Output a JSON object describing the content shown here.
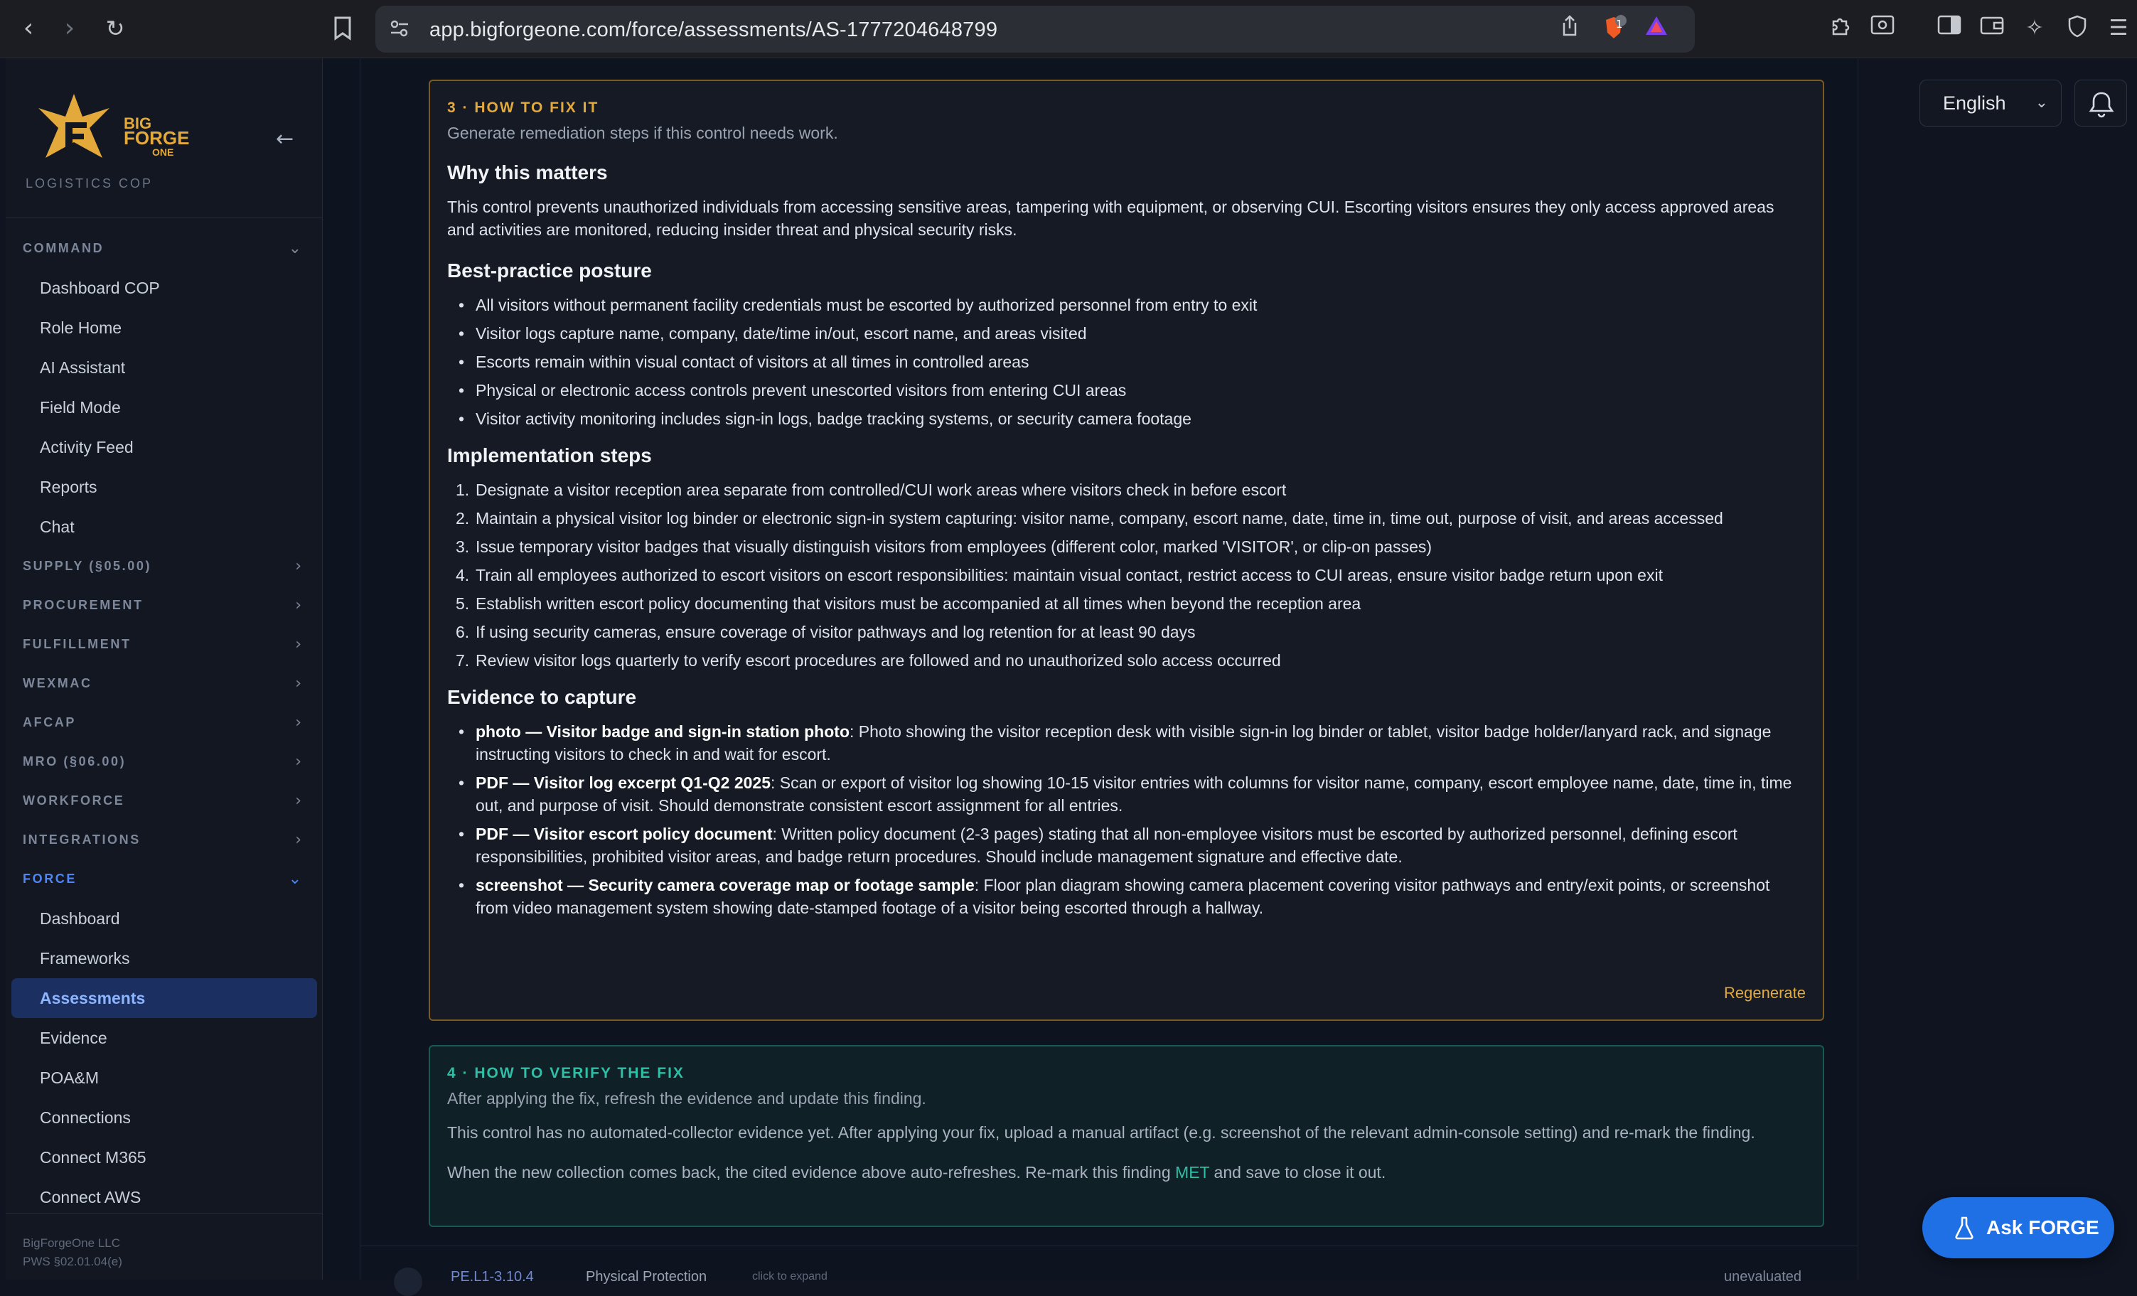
{
  "browser": {
    "url": "app.bigforgeone.com/force/assessments/AS-1777204648799",
    "shields_count": "1"
  },
  "sidebar": {
    "brand_line1": "BIG",
    "brand_line2": "FORGE",
    "brand_line3": "ONE",
    "brand_sub": "LOGISTICS COP",
    "sections": [
      {
        "label": "COMMAND",
        "expanded": true,
        "items": [
          "Dashboard COP",
          "Role Home",
          "AI Assistant",
          "Field Mode",
          "Activity Feed",
          "Reports",
          "Chat"
        ]
      },
      {
        "label": "SUPPLY (§05.00)",
        "expanded": false,
        "items": []
      },
      {
        "label": "PROCUREMENT",
        "expanded": false,
        "items": []
      },
      {
        "label": "FULFILLMENT",
        "expanded": false,
        "items": []
      },
      {
        "label": "WEXMAC",
        "expanded": false,
        "items": []
      },
      {
        "label": "AFCAP",
        "expanded": false,
        "items": []
      },
      {
        "label": "MRO (§06.00)",
        "expanded": false,
        "items": []
      },
      {
        "label": "WORKFORCE",
        "expanded": false,
        "items": []
      },
      {
        "label": "INTEGRATIONS",
        "expanded": false,
        "items": []
      },
      {
        "label": "FORCE",
        "expanded": true,
        "active": true,
        "items": [
          "Dashboard",
          "Frameworks",
          "Assessments",
          "Evidence",
          "POA&M",
          "Connections",
          "Connect M365",
          "Connect AWS"
        ]
      }
    ],
    "active_item": "Assessments",
    "footer_line1": "BigForgeOne LLC",
    "footer_line2": "PWS §02.01.04(e)"
  },
  "fix": {
    "label": "3 · HOW TO FIX IT",
    "subtitle": "Generate remediation steps if this control needs work.",
    "why_heading": "Why this matters",
    "why_text": "This control prevents unauthorized individuals from accessing sensitive areas, tampering with equipment, or observing CUI. Escorting visitors ensures they only access approved areas and activities are monitored, reducing insider threat and physical security risks.",
    "posture_heading": "Best-practice posture",
    "posture": [
      "All visitors without permanent facility credentials must be escorted by authorized personnel from entry to exit",
      "Visitor logs capture name, company, date/time in/out, escort name, and areas visited",
      "Escorts remain within visual contact of visitors at all times in controlled areas",
      "Physical or electronic access controls prevent unescorted visitors from entering CUI areas",
      "Visitor activity monitoring includes sign-in logs, badge tracking systems, or security camera footage"
    ],
    "steps_heading": "Implementation steps",
    "steps": [
      "Designate a visitor reception area separate from controlled/CUI work areas where visitors check in before escort",
      "Maintain a physical visitor log binder or electronic sign-in system capturing: visitor name, company, escort name, date, time in, time out, purpose of visit, and areas accessed",
      "Issue temporary visitor badges that visually distinguish visitors from employees (different color, marked 'VISITOR', or clip-on passes)",
      "Train all employees authorized to escort visitors on escort responsibilities: maintain visual contact, restrict access to CUI areas, ensure visitor badge return upon exit",
      "Establish written escort policy documenting that visitors must be accompanied at all times when beyond the reception area",
      "If using security cameras, ensure coverage of visitor pathways and log retention for at least 90 days",
      "Review visitor logs quarterly to verify escort procedures are followed and no unauthorized solo access occurred"
    ],
    "evidence_heading": "Evidence to capture",
    "evidence": [
      {
        "title": "photo — Visitor badge and sign-in station photo",
        "text": ": Photo showing the visitor reception desk with visible sign-in log binder or tablet, visitor badge holder/lanyard rack, and signage instructing visitors to check in and wait for escort."
      },
      {
        "title": "PDF — Visitor log excerpt Q1-Q2 2025",
        "text": ": Scan or export of visitor log showing 10-15 visitor entries with columns for visitor name, company, escort employee name, date, time in, time out, and purpose of visit. Should demonstrate consistent escort assignment for all entries."
      },
      {
        "title": "PDF — Visitor escort policy document",
        "text": ": Written policy document (2-3 pages) stating that all non-employee visitors must be escorted by authorized personnel, defining escort responsibilities, prohibited visitor areas, and badge return procedures. Should include management signature and effective date."
      },
      {
        "title": "screenshot — Security camera coverage map or footage sample",
        "text": ": Floor plan diagram showing camera placement covering visitor pathways and entry/exit points, or screenshot from video management system showing date-stamped footage of a visitor being escorted through a hallway."
      }
    ],
    "regenerate": "Regenerate"
  },
  "verify": {
    "label": "4 · HOW TO VERIFY THE FIX",
    "subtitle": "After applying the fix, refresh the evidence and update this finding.",
    "text1": "This control has no automated-collector evidence yet. After applying your fix, upload a manual artifact (e.g. screenshot of the relevant admin-console setting) and re-mark the finding.",
    "text2_before": "When the new collection comes back, the cited evidence above auto-refreshes. Re-mark this finding ",
    "text2_met": "MET",
    "text2_after": " and save to close it out."
  },
  "next_row": {
    "code": "PE.L1-3.10.4",
    "family": "Physical Protection",
    "hint": "click to expand",
    "status": "unevaluated"
  },
  "topright": {
    "language": "English"
  },
  "ask": {
    "label": "Ask FORGE"
  },
  "colors": {
    "accent": "#1f6fe5",
    "fix_border": "#7a5a1e",
    "fix_label": "#e3a93a",
    "verify_border": "#175a55",
    "verify_label": "#2fbfa6"
  }
}
